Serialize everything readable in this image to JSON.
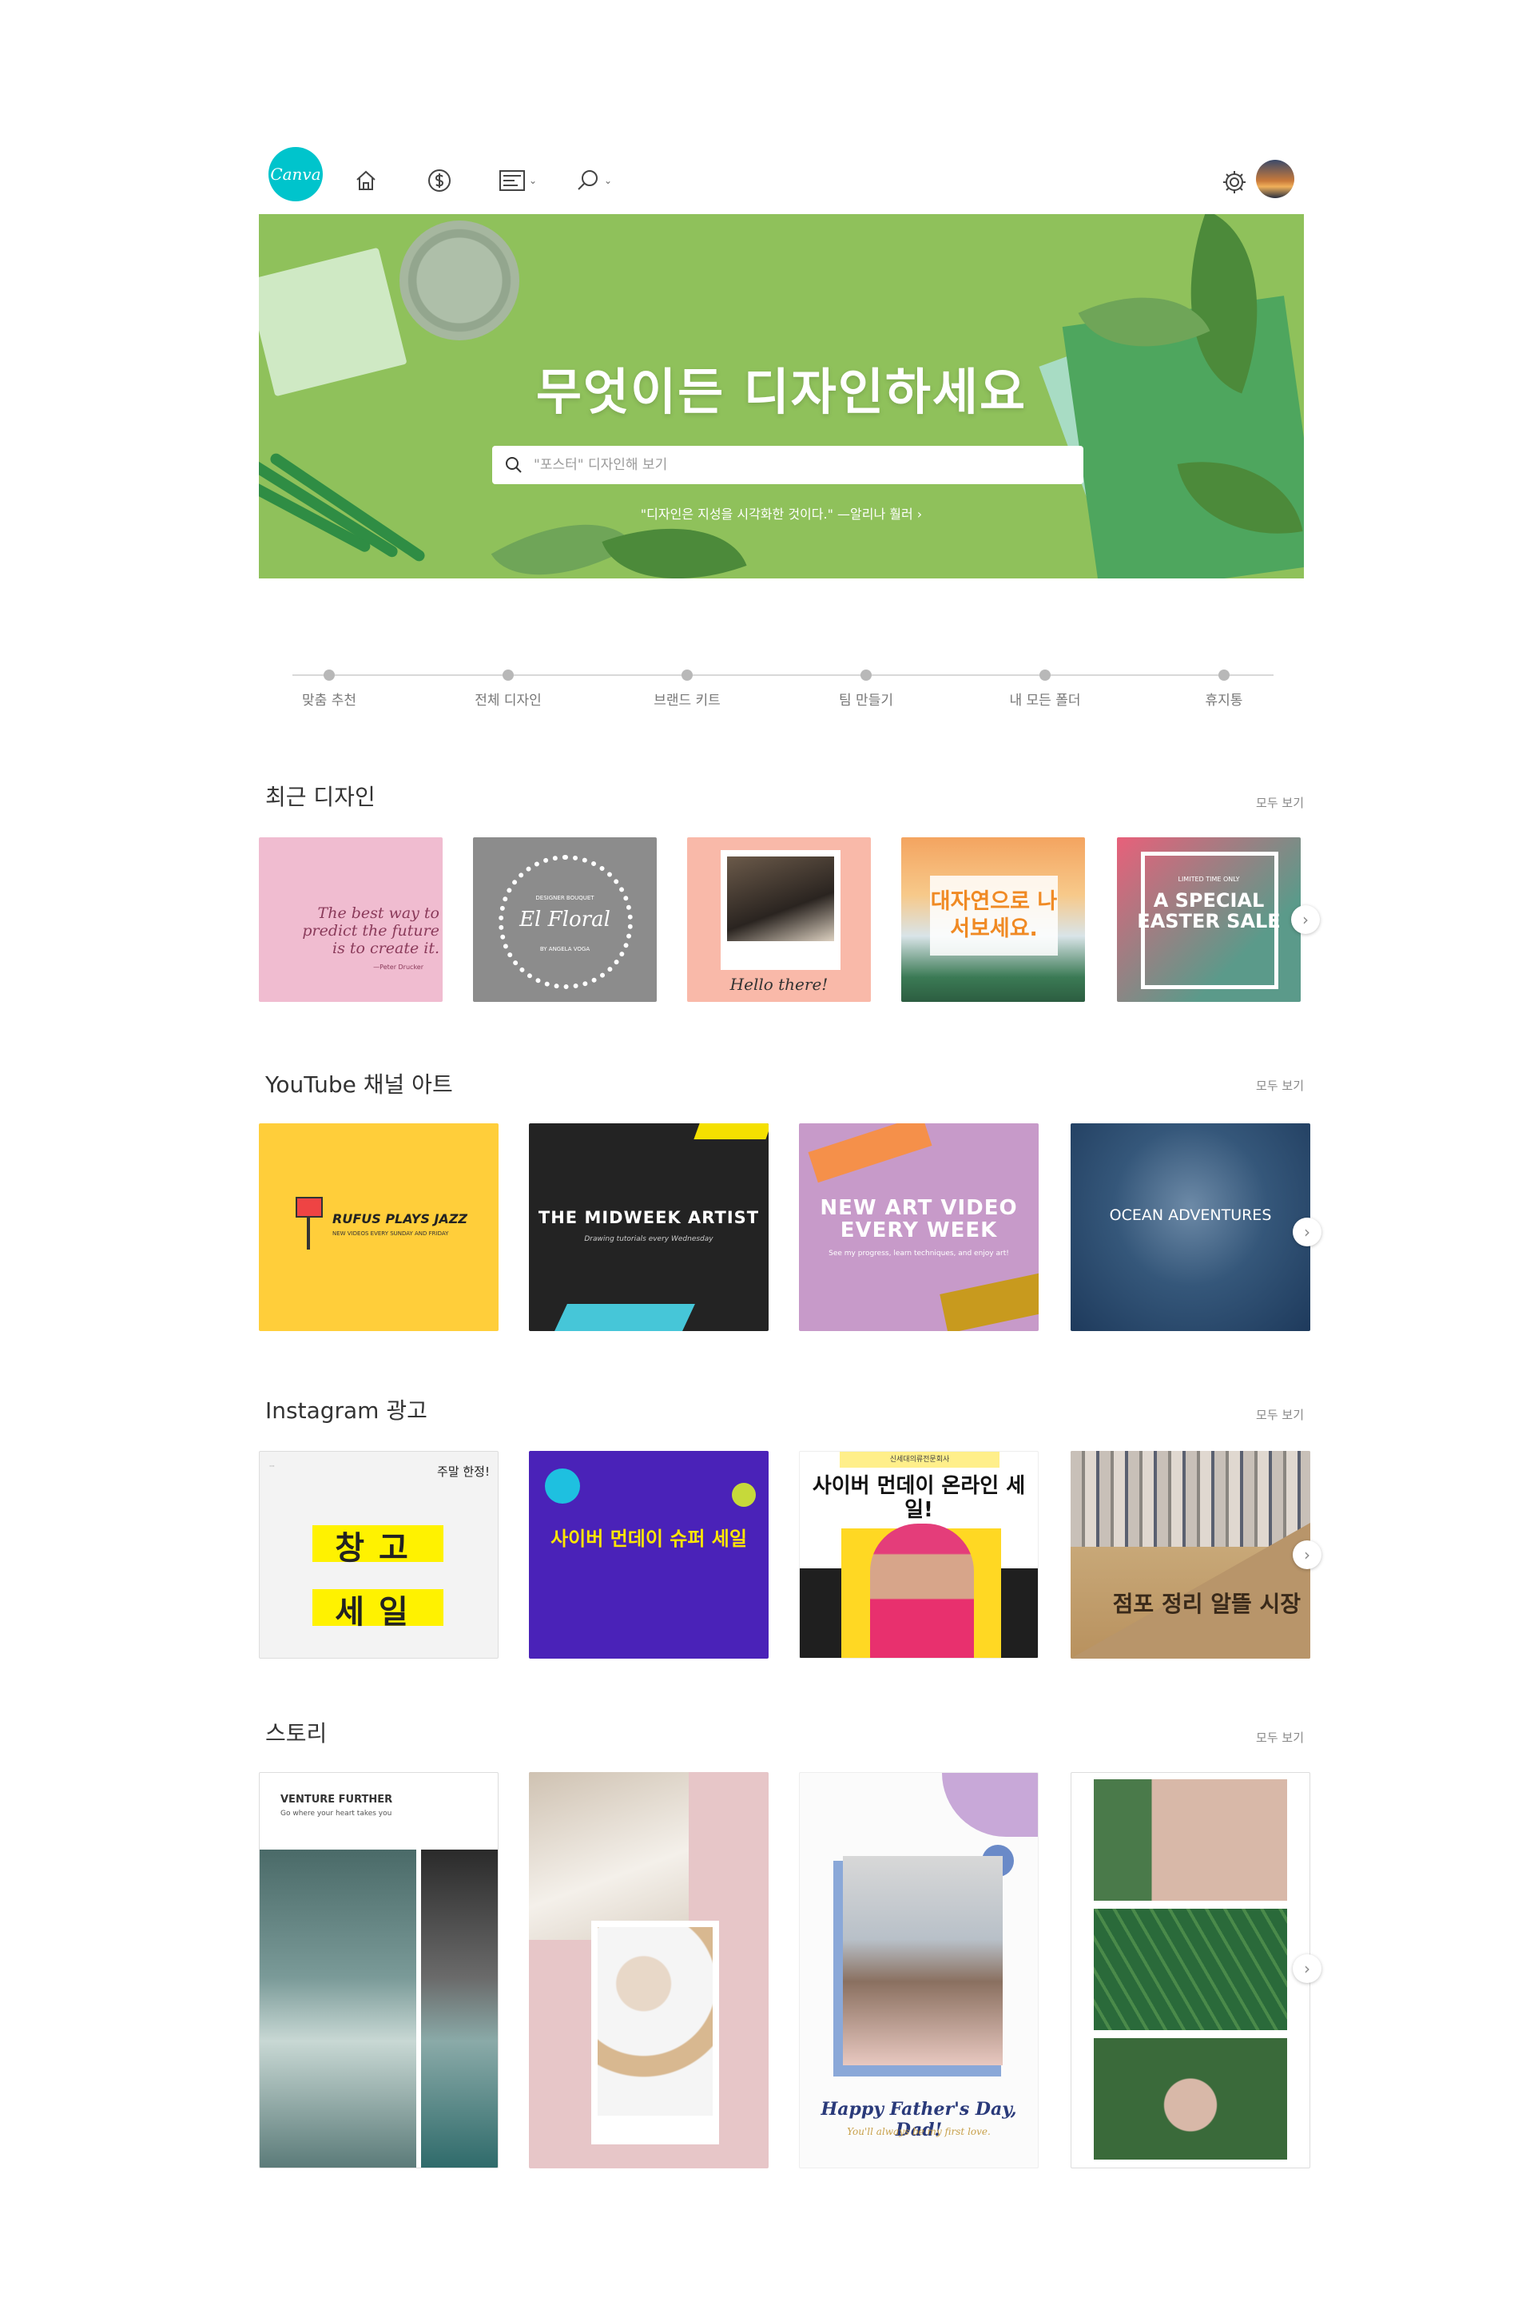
{
  "app": {
    "logo_text": "Canva",
    "brand_color": "#00c4cc"
  },
  "nav": {
    "icons": [
      "home-icon",
      "dollar-icon",
      "templates-icon",
      "search-icon"
    ],
    "settings_icon": "gear-icon"
  },
  "hero": {
    "title": "무엇이든 디자인하세요",
    "search_placeholder": "\"포스터\" 디자인해 보기",
    "quote": "\"디자인은 지성을 시각화한 것이다.\" —알리나 훨러 ›"
  },
  "steps": [
    {
      "label": "맞춤 추천"
    },
    {
      "label": "전체 디자인"
    },
    {
      "label": "브랜드 키트"
    },
    {
      "label": "팀 만들기"
    },
    {
      "label": "내 모든 폴더"
    },
    {
      "label": "휴지통"
    }
  ],
  "recent": {
    "title": "최근 디자인",
    "see_all": "모두 보기",
    "items": {
      "r1_text": "The best way to predict the future is to create it.",
      "r1_by": "—Peter Drucker",
      "r2_top": "DESIGNER BOUQUET",
      "r2_name": "El Floral",
      "r2_bottom": "BY ANGELA VOGA",
      "r3_text": "Hello there!",
      "r4_text": "대자연으로 나서보세요.",
      "r5_small": "LIMITED TIME ONLY",
      "r5_text": "A SPECIAL EASTER SALE"
    }
  },
  "youtube": {
    "title": "YouTube 채널 아트",
    "see_all": "모두 보기",
    "items": {
      "y1_title": "RUFUS PLAYS JAZZ",
      "y1_sub": "NEW VIDEOS EVERY SUNDAY AND FRIDAY",
      "y2_title": "THE MIDWEEK ARTIST",
      "y2_sub": "Drawing tutorials every Wednesday",
      "y3_title": "NEW ART VIDEO EVERY WEEK",
      "y3_sub": "See my progress, learn techniques, and enjoy art!",
      "y4_title": "OCEAN ADVENTURES"
    }
  },
  "instagram": {
    "title": "Instagram 광고",
    "see_all": "모두 보기",
    "items": {
      "i1_top": "주말 한정!",
      "i1_w1": "창고",
      "i1_w2": "세일",
      "i2_title": "사이버 먼데이 슈퍼 세일",
      "i3_banner": "신세대의류전문회사",
      "i3_title": "사이버 먼데이 온라인 세일!",
      "i4_title": "점포 정리 알뜰 시장"
    }
  },
  "stories": {
    "title": "스토리",
    "see_all": "모두 보기",
    "items": {
      "s1_title": "VENTURE FURTHER",
      "s1_sub": "Go where your heart takes you",
      "s3_title": "Happy Father's Day, Dad!",
      "s3_sub": "You'll always be my first love."
    }
  }
}
